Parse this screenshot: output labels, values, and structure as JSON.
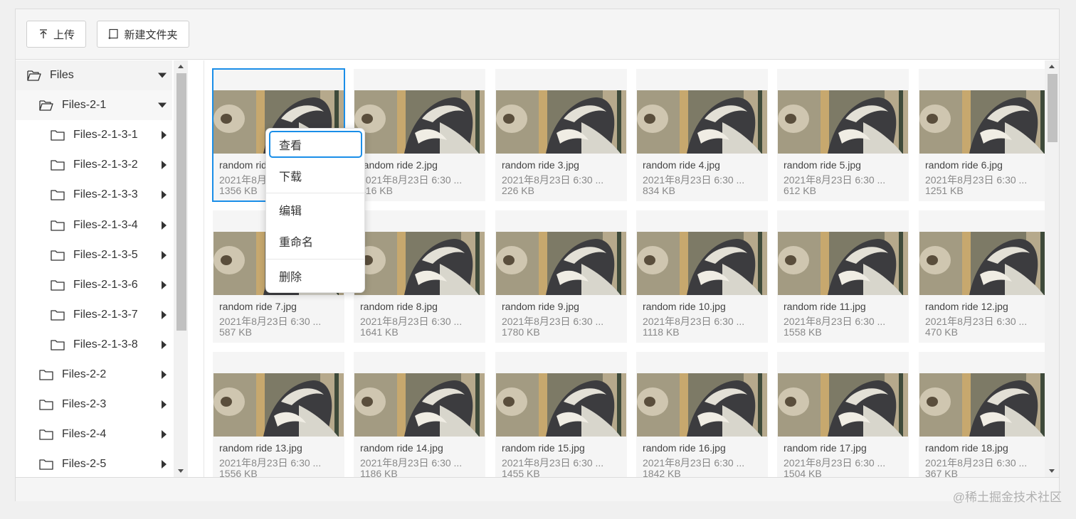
{
  "toolbar": {
    "upload_label": "上传",
    "new_folder_label": "新建文件夹"
  },
  "tree": {
    "items": [
      {
        "label": "Files",
        "level": 0,
        "expanded": true
      },
      {
        "label": "Files-2-1",
        "level": 1,
        "expanded": true
      },
      {
        "label": "Files-2-1-3-1",
        "level": 2,
        "expanded": false
      },
      {
        "label": "Files-2-1-3-2",
        "level": 2,
        "expanded": false
      },
      {
        "label": "Files-2-1-3-3",
        "level": 2,
        "expanded": false
      },
      {
        "label": "Files-2-1-3-4",
        "level": 2,
        "expanded": false
      },
      {
        "label": "Files-2-1-3-5",
        "level": 2,
        "expanded": false
      },
      {
        "label": "Files-2-1-3-6",
        "level": 2,
        "expanded": false
      },
      {
        "label": "Files-2-1-3-7",
        "level": 2,
        "expanded": false
      },
      {
        "label": "Files-2-1-3-8",
        "level": 2,
        "expanded": false
      },
      {
        "label": "Files-2-2",
        "level": 1,
        "expanded": false
      },
      {
        "label": "Files-2-3",
        "level": 1,
        "expanded": false
      },
      {
        "label": "Files-2-4",
        "level": 1,
        "expanded": false
      },
      {
        "label": "Files-2-5",
        "level": 1,
        "expanded": false
      }
    ]
  },
  "files": [
    {
      "name": "random ride 1.jpg",
      "date": "2021年8月23日 6:30 ...",
      "size": "1356 KB"
    },
    {
      "name": "random ride 2.jpg",
      "date": "2021年8月23日 6:30 ...",
      "size": "416 KB"
    },
    {
      "name": "random ride 3.jpg",
      "date": "2021年8月23日 6:30 ...",
      "size": "226 KB"
    },
    {
      "name": "random ride 4.jpg",
      "date": "2021年8月23日 6:30 ...",
      "size": "834 KB"
    },
    {
      "name": "random ride 5.jpg",
      "date": "2021年8月23日 6:30 ...",
      "size": "612 KB"
    },
    {
      "name": "random ride 6.jpg",
      "date": "2021年8月23日 6:30 ...",
      "size": "1251 KB"
    },
    {
      "name": "random ride 7.jpg",
      "date": "2021年8月23日 6:30 ...",
      "size": "587 KB"
    },
    {
      "name": "random ride 8.jpg",
      "date": "2021年8月23日 6:30 ...",
      "size": "1641 KB"
    },
    {
      "name": "random ride 9.jpg",
      "date": "2021年8月23日 6:30 ...",
      "size": "1780 KB"
    },
    {
      "name": "random ride 10.jpg",
      "date": "2021年8月23日 6:30 ...",
      "size": "1118 KB"
    },
    {
      "name": "random ride 11.jpg",
      "date": "2021年8月23日 6:30 ...",
      "size": "1558 KB"
    },
    {
      "name": "random ride 12.jpg",
      "date": "2021年8月23日 6:30 ...",
      "size": "470 KB"
    },
    {
      "name": "random ride 13.jpg",
      "date": "2021年8月23日 6:30 ...",
      "size": "1556 KB"
    },
    {
      "name": "random ride 14.jpg",
      "date": "2021年8月23日 6:30 ...",
      "size": "1186 KB"
    },
    {
      "name": "random ride 15.jpg",
      "date": "2021年8月23日 6:30 ...",
      "size": "1455 KB"
    },
    {
      "name": "random ride 16.jpg",
      "date": "2021年8月23日 6:30 ...",
      "size": "1842 KB"
    },
    {
      "name": "random ride 17.jpg",
      "date": "2021年8月23日 6:30 ...",
      "size": "1504 KB"
    },
    {
      "name": "random ride 18.jpg",
      "date": "2021年8月23日 6:30 ...",
      "size": "367 KB"
    }
  ],
  "selected_file_index": 0,
  "context_menu": {
    "items": [
      "查看",
      "下载",
      "编辑",
      "重命名",
      "删除"
    ],
    "focused_index": 0
  },
  "watermark": "@稀土掘金技术社区",
  "colors": {
    "accent": "#1a8ee8",
    "toolbar_bg": "#f5f5f5",
    "card_bg": "#f5f5f5"
  }
}
